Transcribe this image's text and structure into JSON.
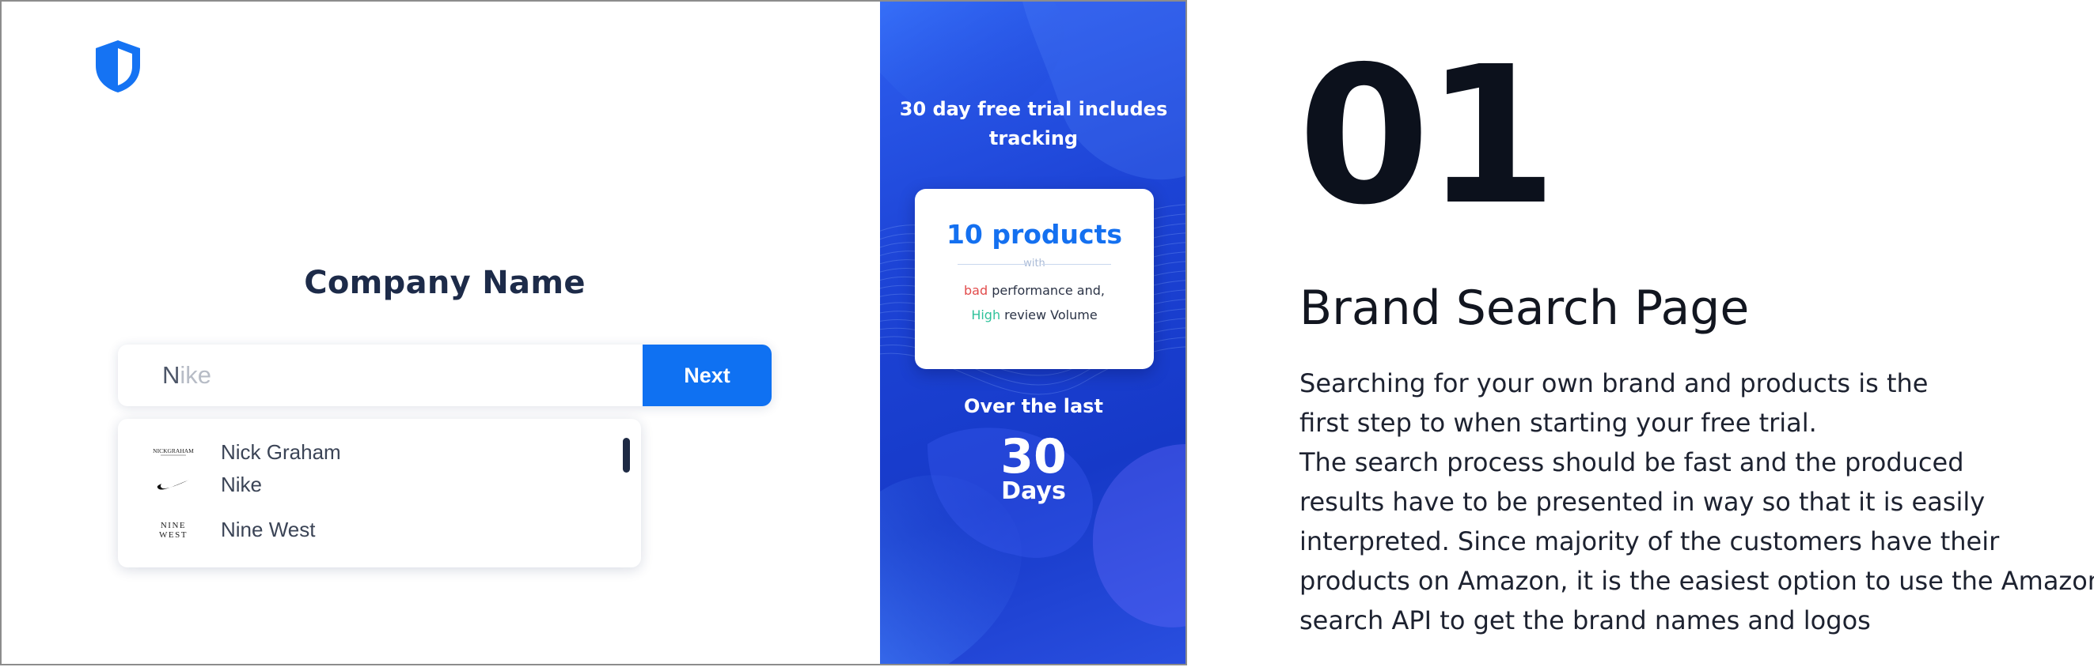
{
  "app": {
    "logo_icon": "shield-icon",
    "company_name": "Company Name",
    "search": {
      "typed": "N",
      "suggestion_rest": "ike",
      "next_label": "Next"
    },
    "dropdown": [
      {
        "label": "Nick Graham",
        "logo_text": "NICKGRAHAM",
        "icon": "nick-graham-logo"
      },
      {
        "label": "Nike",
        "icon": "nike-swoosh-logo"
      },
      {
        "label": "Nine West",
        "logo_text_top": "NINE",
        "logo_text_bottom": "WEST",
        "icon": "nine-west-logo"
      }
    ]
  },
  "promo": {
    "heading_line1": "30 day free trial includes",
    "heading_line2": "tracking",
    "card": {
      "big": "10 products",
      "with": "with",
      "bad_word": "bad",
      "bad_rest": " performance and,",
      "high_word": "High",
      "high_rest": " review Volume"
    },
    "over": "Over the last",
    "number": "30",
    "unit": "Days"
  },
  "description": {
    "step": "01",
    "title": "Brand Search Page",
    "lines": [
      "Searching for your own brand and products is the",
      "first step to when starting your free trial.",
      "The search process should be fast and the produced",
      "results have to be presented in way so that it is easily",
      "interpreted. Since majority of the customers have their",
      "products on Amazon, it is the easiest option to use the Amazon",
      "search API to get the brand names and logos"
    ]
  },
  "colors": {
    "accent": "#0f71f2",
    "navy": "#1d2b49",
    "bad": "#e24c4c",
    "high": "#2fc29b"
  }
}
